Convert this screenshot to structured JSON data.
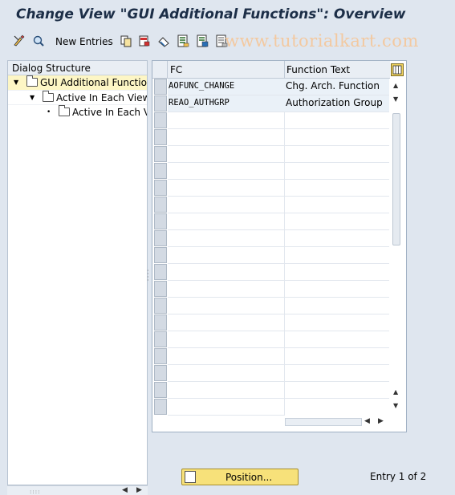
{
  "window": {
    "title": "Change View \"GUI Additional Functions\": Overview"
  },
  "toolbar": {
    "new_entries_label": "New Entries",
    "icons": [
      "display-change-icon",
      "find-icon",
      "copy-icon",
      "delete-icon",
      "undo-icon",
      "select-all-icon",
      "select-block-icon",
      "deselect-all-icon"
    ]
  },
  "watermark": "www.tutorialkart.com",
  "dialog_structure": {
    "header": "Dialog Structure",
    "items": [
      {
        "label": "GUI Additional Functions",
        "level": 0,
        "selected": true
      },
      {
        "label": "Active In Each View",
        "level": 1,
        "selected": false
      },
      {
        "label": "Active In Each Vi",
        "level": 2,
        "selected": false
      }
    ]
  },
  "table": {
    "columns": [
      "FC",
      "Function Text"
    ],
    "rows": [
      {
        "fc": "AOFUNC_CHANGE",
        "text": "Chg. Arch. Function"
      },
      {
        "fc": "REAO_AUTHGRP",
        "text": "Authorization Group"
      }
    ],
    "empty_rows": 18
  },
  "footer": {
    "position_button": "Position...",
    "entry_info": "Entry 1 of 2"
  },
  "colors": {
    "accent_yellow": "#f7e17a",
    "background": "#dfe6ef",
    "selected_row": "#eaf1f8"
  }
}
